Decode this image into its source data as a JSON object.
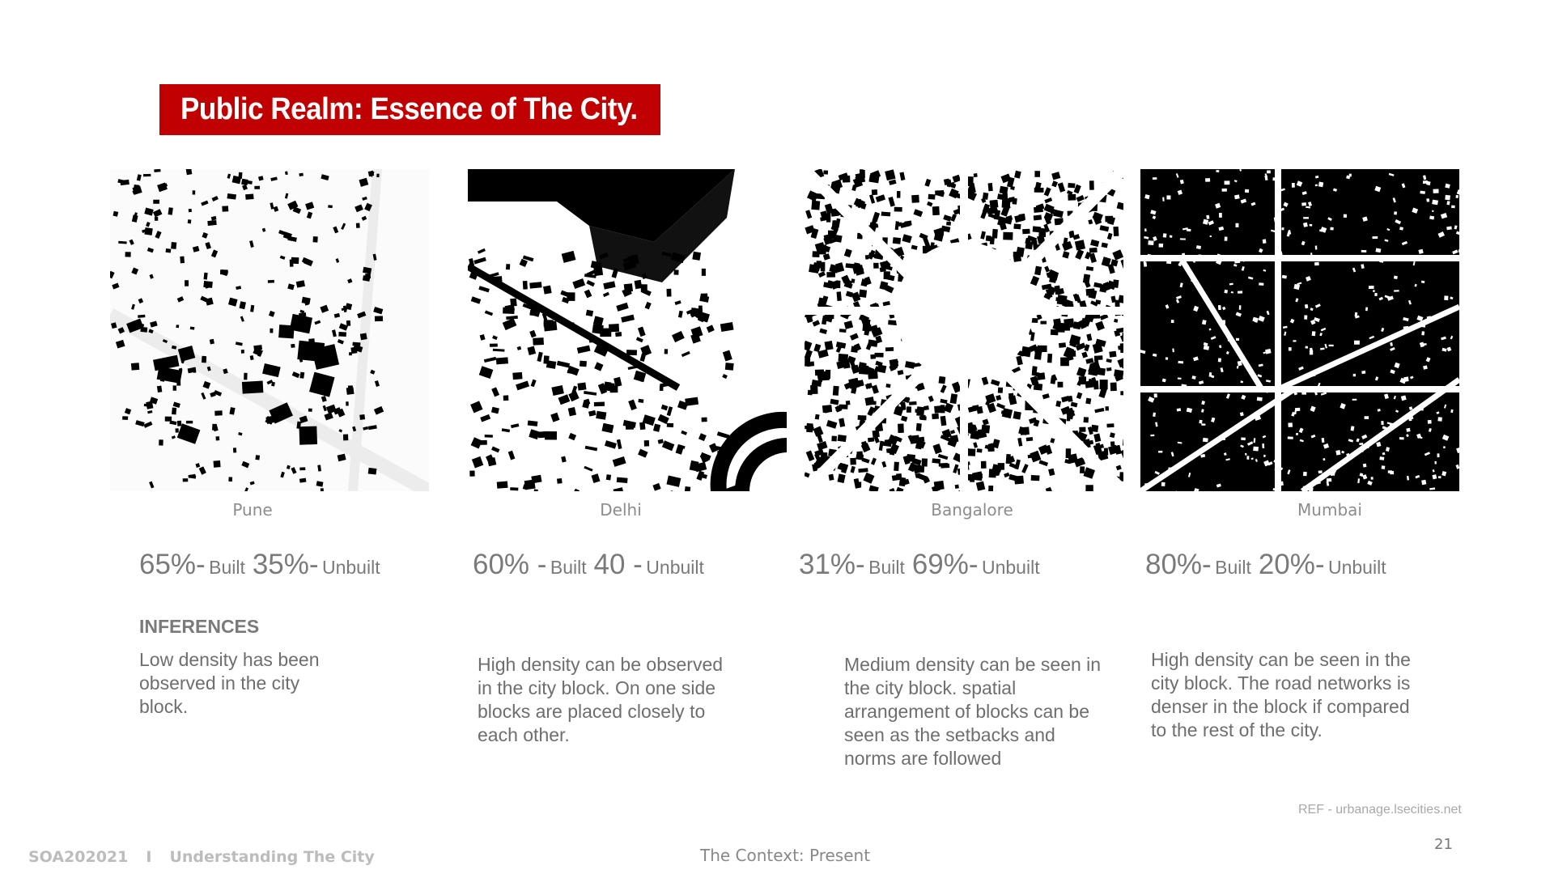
{
  "title": "Public Realm: Essence of The City.",
  "accent_color": "#c00000",
  "cities": [
    {
      "name": "Pune",
      "built_value": "65%-",
      "built_label": "Built",
      "unbuilt_value": "35%-",
      "unbuilt_label": "Unbuilt",
      "inference": "Low density has been observed in the city block."
    },
    {
      "name": "Delhi",
      "built_value": "60% -",
      "built_label": "Built",
      "unbuilt_value": "40 -",
      "unbuilt_label": "Unbuilt",
      "inference": "High density can be observed in the city block. On one side blocks are placed closely to each other."
    },
    {
      "name": "Bangalore",
      "built_value": "31%-",
      "built_label": "Built",
      "unbuilt_value": "69%-",
      "unbuilt_label": "Unbuilt",
      "inference": "Medium density can be seen in the city block. spatial arrangement of blocks can be seen as the setbacks and norms are followed"
    },
    {
      "name": "Mumbai",
      "built_value": "80%-",
      "built_label": "Built",
      "unbuilt_value": "20%-",
      "unbuilt_label": "Unbuilt",
      "inference": "High density can be seen in the city block. The road networks is denser in the block if compared to the rest of the city."
    }
  ],
  "inferences_heading": "INFERENCES",
  "reference": "REF - urbanage.lsecities.net",
  "page_number": "21",
  "footer": {
    "course": "SOA202021",
    "separator": "I",
    "subject": "Understanding The City",
    "section": "The Context: Present"
  }
}
